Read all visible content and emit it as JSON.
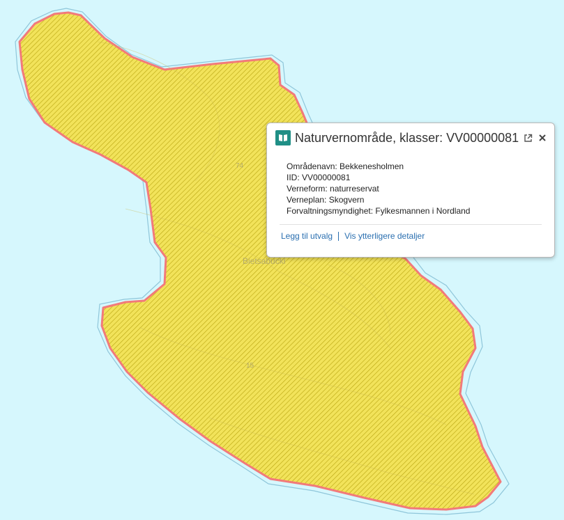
{
  "map": {
    "background_color": "#d6f7fd",
    "polygon_fill": "#f2e35a",
    "polygon_hatch": "#b8a410",
    "polygon_stroke": "#f27a7a",
    "labels": [
      {
        "text": "Bietsabucki"
      },
      {
        "text": "74"
      },
      {
        "text": "15"
      }
    ]
  },
  "popup": {
    "icon": "book-icon",
    "title": "Naturvernområde, klasser: VV00000081",
    "attributes": [
      "Områdenavn: Bekkenesholmen",
      "IID: VV00000081",
      "Verneform: naturreservat",
      "Verneplan: Skogvern",
      "Forvaltningsmyndighet: Fylkesmannen i Nordland"
    ],
    "actions": {
      "add_to_selection": "Legg til utvalg",
      "more_details": "Vis ytterligere detaljer"
    },
    "buttons": {
      "popout": "popout-icon",
      "close": "close-icon"
    }
  }
}
